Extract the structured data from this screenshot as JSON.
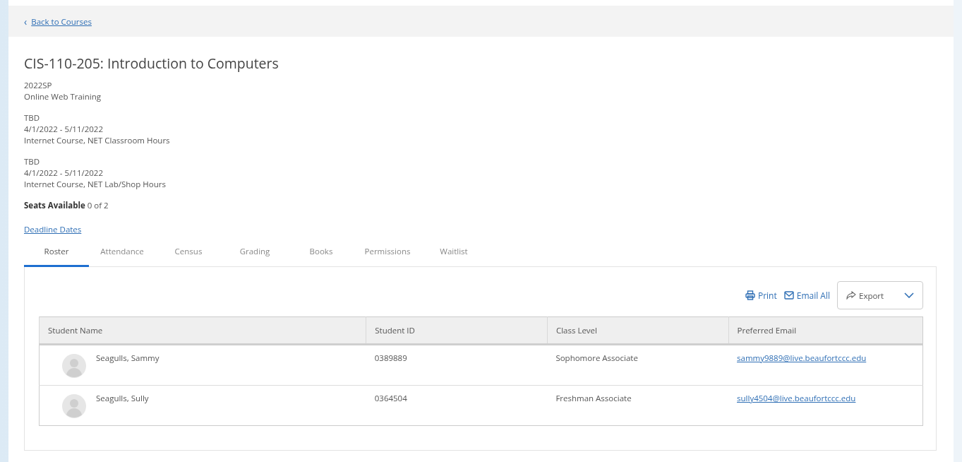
{
  "back_link": {
    "icon": "‹",
    "label": "Back to Courses"
  },
  "course": {
    "title": "CIS-110-205: Introduction to Computers",
    "term": "2022SP",
    "delivery": "Online Web Training",
    "meetings": [
      {
        "time": "TBD",
        "dates": "4/1/2022 - 5/11/2022",
        "type": "Internet Course, NET Classroom Hours"
      },
      {
        "time": "TBD",
        "dates": "4/1/2022 - 5/11/2022",
        "type": "Internet Course, NET Lab/Shop Hours"
      }
    ]
  },
  "seats": {
    "label": "Seats Available",
    "value": "0 of 2"
  },
  "deadline_link": "Deadline Dates",
  "tabs": [
    {
      "label": "Roster",
      "selected": true
    },
    {
      "label": "Attendance",
      "selected": false
    },
    {
      "label": "Census",
      "selected": false
    },
    {
      "label": "Grading",
      "selected": false
    },
    {
      "label": "Books",
      "selected": false
    },
    {
      "label": "Permissions",
      "selected": false
    },
    {
      "label": "Waitlist",
      "selected": false
    }
  ],
  "toolbar": {
    "print": "Print",
    "email_all": "Email All",
    "export": "Export"
  },
  "table": {
    "columns": [
      "Student Name",
      "Student ID",
      "Class Level",
      "Preferred Email"
    ],
    "rows": [
      {
        "student_name": "Seagulls, Sammy",
        "student_id": "0389889",
        "class_level": "Sophomore Associate",
        "preferred_email": "sammy9889@live.beaufortccc.edu"
      },
      {
        "student_name": "Seagulls, Sully",
        "student_id": "0364504",
        "class_level": "Freshman Associate",
        "preferred_email": "sully4504@live.beaufortccc.edu"
      }
    ]
  }
}
